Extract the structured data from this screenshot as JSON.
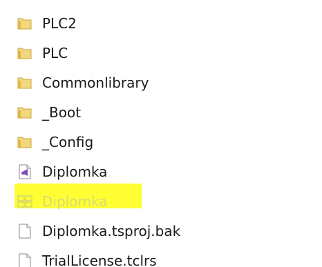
{
  "items": [
    {
      "name": "PLC2",
      "type": "folder"
    },
    {
      "name": "PLC",
      "type": "folder"
    },
    {
      "name": "Commonlibrary",
      "type": "folder"
    },
    {
      "name": "_Boot",
      "type": "folder"
    },
    {
      "name": "_Config",
      "type": "folder"
    },
    {
      "name": "Diplomka",
      "type": "visual-studio-solution"
    },
    {
      "name": "Diplomka",
      "type": "twincat-project",
      "highlighted": true
    },
    {
      "name": "Diplomka.tsproj.bak",
      "type": "file"
    },
    {
      "name": "TrialLicense.tclrs",
      "type": "file"
    }
  ],
  "colors": {
    "highlight": "#ffff33",
    "folder": "#e8c25a",
    "vs_purple": "#7d4bb5"
  }
}
